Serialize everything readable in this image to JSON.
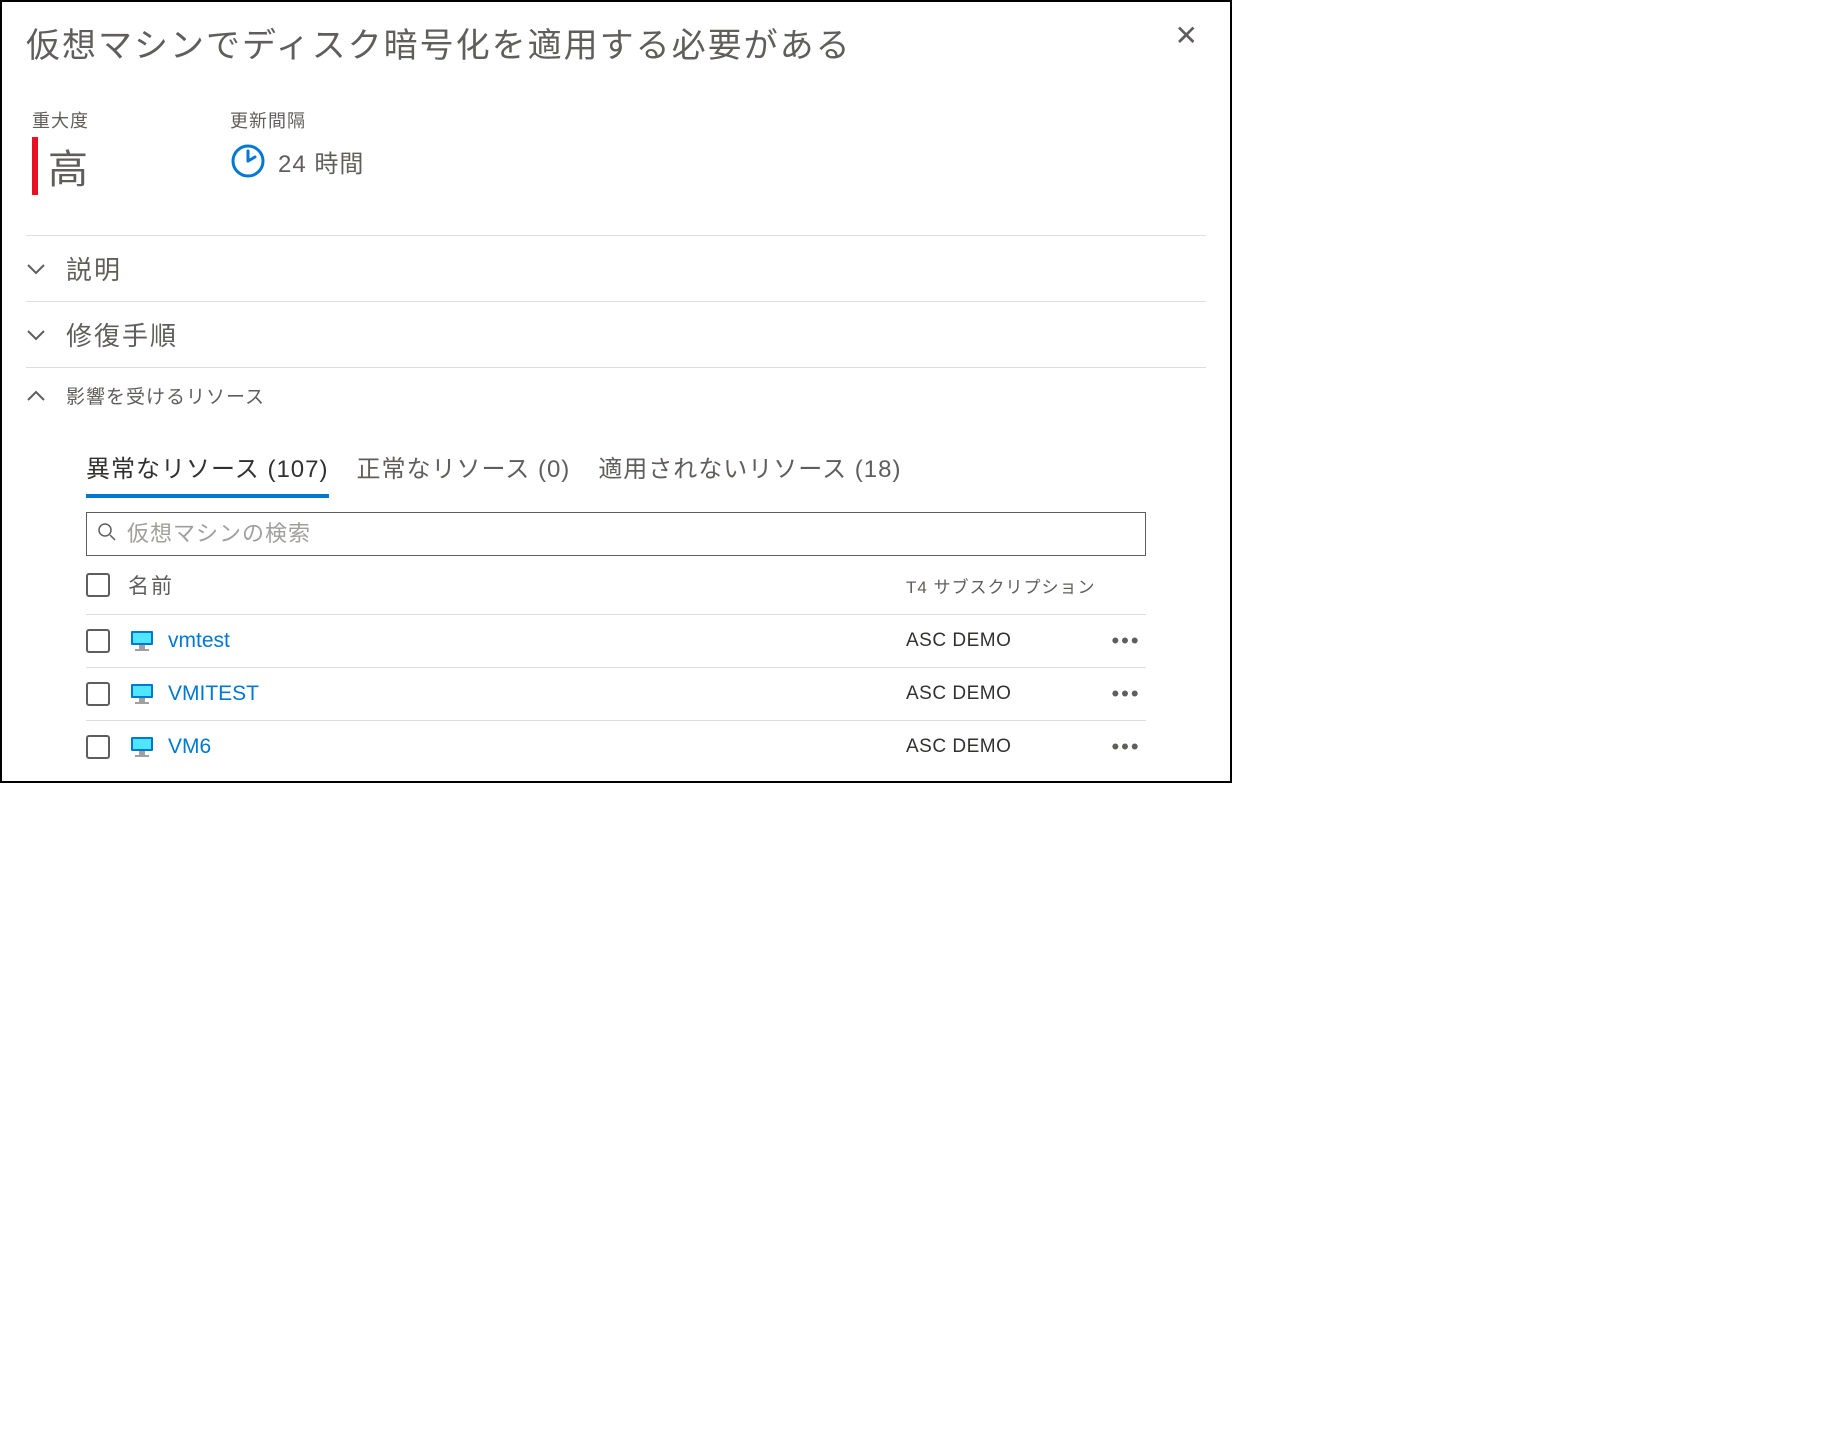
{
  "title": "仮想マシンでディスク暗号化を適用する必要がある",
  "severity": {
    "label": "重大度",
    "value": "高"
  },
  "refresh": {
    "label": "更新間隔",
    "value": "24 時間"
  },
  "sections": {
    "description": "説明",
    "remediation": "修復手順",
    "affected": "影響を受けるリソース"
  },
  "tabs": {
    "unhealthy": "異常なリソース (107)",
    "healthy": "正常なリソース (0)",
    "not_applicable": "適用されないリソース (18)"
  },
  "search": {
    "placeholder": "仮想マシンの検索"
  },
  "table": {
    "header_name": "名前",
    "header_sub": "T4 サブスクリプション",
    "rows": [
      {
        "name": "vmtest",
        "subscription": "ASC DEMO"
      },
      {
        "name": "VMITEST",
        "subscription": "ASC DEMO"
      },
      {
        "name": "VM6",
        "subscription": "ASC DEMO"
      }
    ]
  }
}
